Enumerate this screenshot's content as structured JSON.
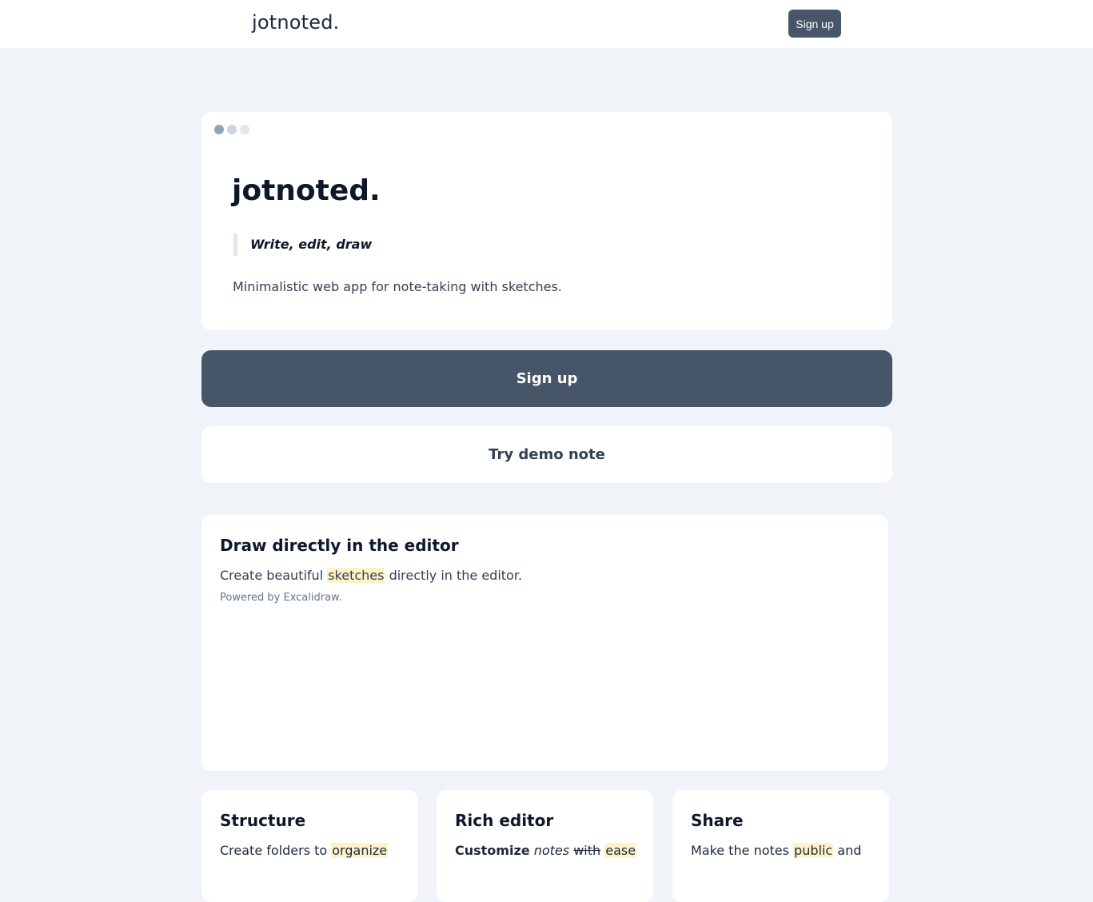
{
  "header": {
    "brand": "jotnoted.",
    "signup_label": "Sign up"
  },
  "hero": {
    "title": "jotnoted.",
    "tagline": "Write, edit, draw",
    "description": "Minimalistic web app for note-taking with sketches."
  },
  "actions": {
    "signup_label": "Sign up",
    "demo_label": "Try demo note"
  },
  "draw_section": {
    "title": "Draw directly in the editor",
    "text_before": "Create beautiful ",
    "highlight": "sketches",
    "text_after": " directly in the editor.",
    "powered_by": "Powered by Excalidraw."
  },
  "features": {
    "structure": {
      "title": "Structure",
      "text_before": "Create folders to ",
      "highlight": "organize"
    },
    "rich_editor": {
      "title": "Rich editor",
      "bold": "Customize",
      "italic": "notes",
      "strike": "with",
      "highlight": "ease"
    },
    "share": {
      "title": "Share",
      "text_before": "Make the notes ",
      "highlight": "public",
      "text_after": " and"
    }
  },
  "colors": {
    "page_bg": "#f0f4f8",
    "primary": "#475569",
    "highlight": "#fef3c7",
    "dot_1": "#94a3b8",
    "dot_2": "#cbd5e1",
    "dot_3": "#e2e8f0"
  }
}
